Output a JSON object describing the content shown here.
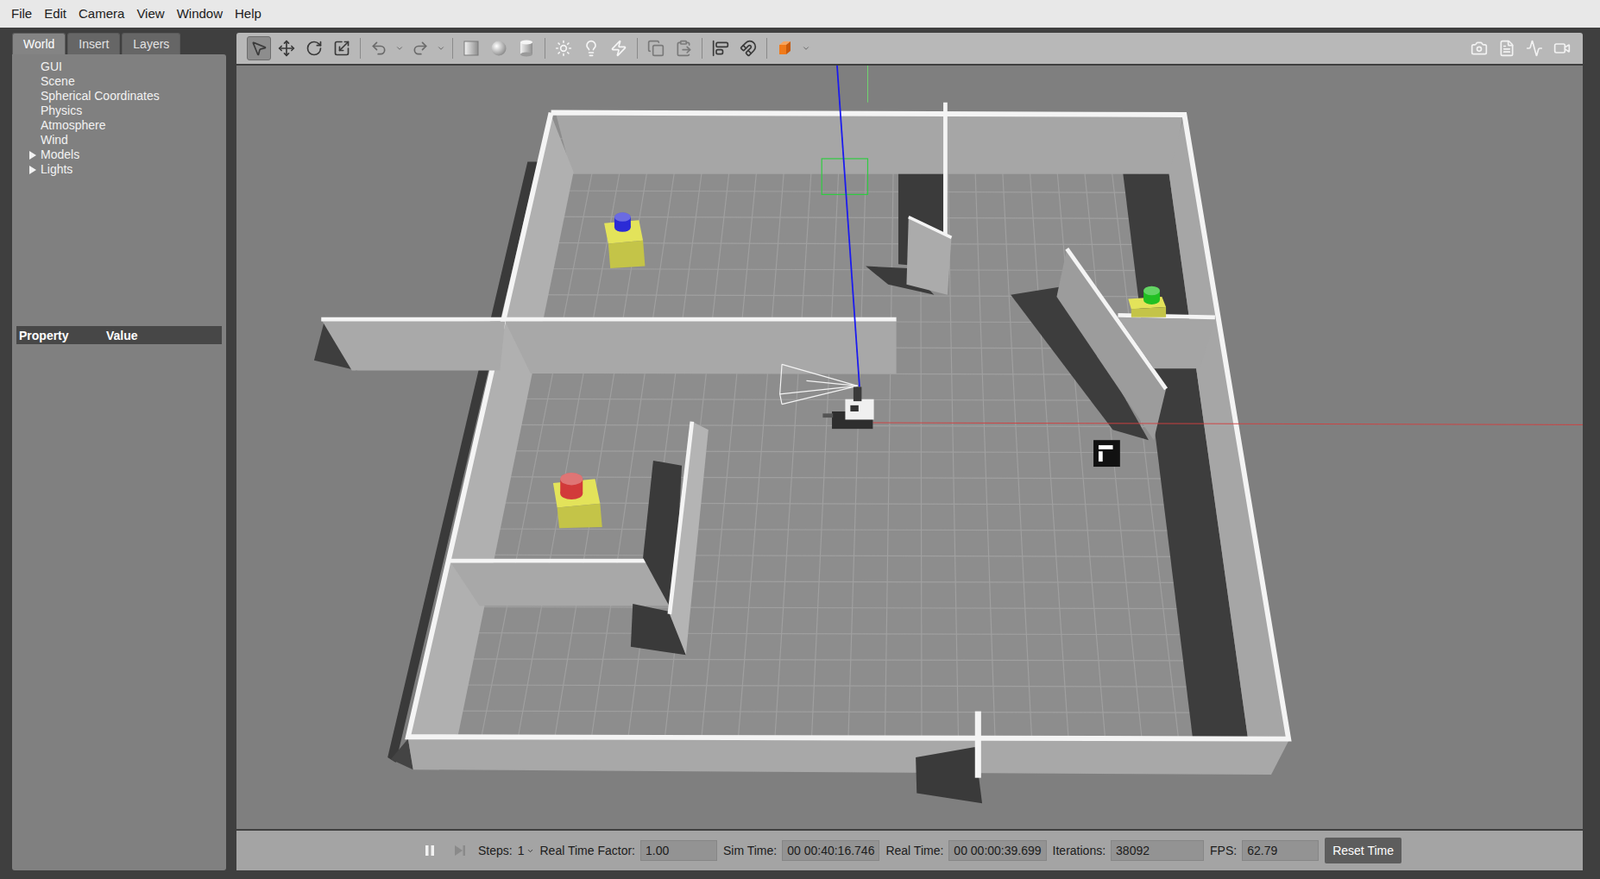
{
  "menu": [
    "File",
    "Edit",
    "Camera",
    "View",
    "Window",
    "Help"
  ],
  "sidebar": {
    "tabs": [
      {
        "label": "World",
        "selected": true
      },
      {
        "label": "Insert",
        "selected": false
      },
      {
        "label": "Layers",
        "selected": false
      }
    ],
    "tree": [
      {
        "label": "GUI",
        "expandable": false,
        "expanded": false
      },
      {
        "label": "Scene",
        "expandable": false,
        "expanded": false
      },
      {
        "label": "Spherical Coordinates",
        "expandable": false,
        "expanded": false
      },
      {
        "label": "Physics",
        "expandable": false,
        "expanded": false
      },
      {
        "label": "Atmosphere",
        "expandable": false,
        "expanded": false
      },
      {
        "label": "Wind",
        "expandable": false,
        "expanded": false
      },
      {
        "label": "Models",
        "expandable": true,
        "expanded": false
      },
      {
        "label": "Lights",
        "expandable": true,
        "expanded": false
      }
    ],
    "property_table": {
      "columns": [
        "Property",
        "Value"
      ]
    }
  },
  "toolbar": {
    "tools": [
      {
        "kind": "select",
        "selected": true
      },
      {
        "kind": "translate",
        "selected": false
      },
      {
        "kind": "rotate",
        "selected": false
      },
      {
        "kind": "scale",
        "selected": false
      }
    ]
  },
  "scene": {
    "targets": [
      {
        "color": "#2b2bd6"
      },
      {
        "color": "#d23a3a"
      },
      {
        "color": "#22c022"
      }
    ]
  },
  "status_bar": {
    "running": true,
    "steps": {
      "label": "Steps:",
      "value": "1"
    },
    "fields": [
      {
        "label": "Real Time Factor:",
        "value": "1.00"
      },
      {
        "label": "Sim Time:",
        "value": "00 00:40:16.746"
      },
      {
        "label": "Real Time:",
        "value": "00 00:00:39.699"
      },
      {
        "label": "Iterations:",
        "value": "38092"
      },
      {
        "label": "FPS:",
        "value": "62.79"
      }
    ],
    "reset_button": "Reset Time"
  }
}
